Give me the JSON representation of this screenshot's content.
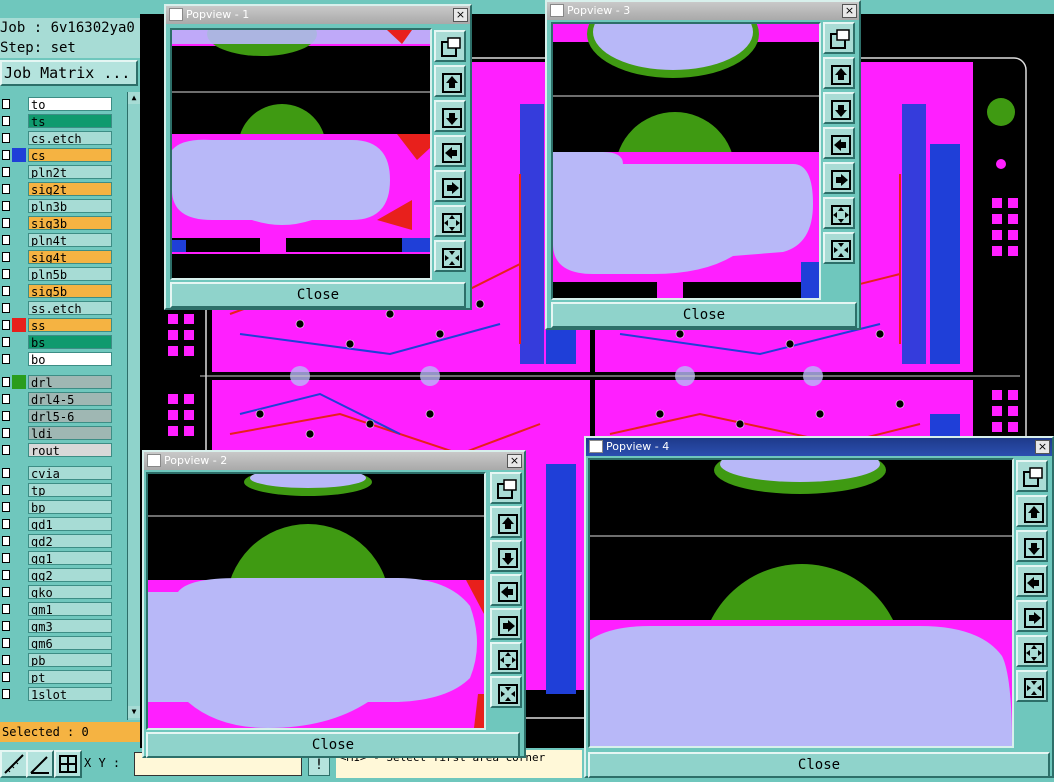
{
  "job_panel": {
    "job_line": "Job : 6v16302ya0",
    "step_line": "Step: set",
    "matrix_button": "Job Matrix ..."
  },
  "layers": [
    {
      "name": "to",
      "color": "#ffffff",
      "dot": ""
    },
    {
      "name": "ts",
      "color": "#0f9a6e",
      "dot": ""
    },
    {
      "name": "cs.etch",
      "color": "#a7dcd5",
      "dot": ""
    },
    {
      "name": "cs",
      "color": "#f5b342",
      "dot": "#1f3fd8"
    },
    {
      "name": "pln2t",
      "color": "#a7dcd5",
      "dot": ""
    },
    {
      "name": "sig2t",
      "color": "#f5b342",
      "dot": ""
    },
    {
      "name": "pln3b",
      "color": "#a7dcd5",
      "dot": ""
    },
    {
      "name": "sig3b",
      "color": "#f5b342",
      "dot": ""
    },
    {
      "name": "pln4t",
      "color": "#a7dcd5",
      "dot": ""
    },
    {
      "name": "sig4t",
      "color": "#f5b342",
      "dot": ""
    },
    {
      "name": "pln5b",
      "color": "#a7dcd5",
      "dot": ""
    },
    {
      "name": "sig5b",
      "color": "#f5b342",
      "dot": ""
    },
    {
      "name": "ss.etch",
      "color": "#a7dcd5",
      "dot": ""
    },
    {
      "name": "ss",
      "color": "#f5b342",
      "dot": "#e8201c"
    },
    {
      "name": "bs",
      "color": "#0f9a6e",
      "dot": ""
    },
    {
      "name": "bo",
      "color": "#ffffff",
      "dot": ""
    },
    {
      "name": "drl",
      "color": "#9fb7b3",
      "dot": "#2a9d1c"
    },
    {
      "name": "drl4-5",
      "color": "#9fb7b3",
      "dot": ""
    },
    {
      "name": "drl5-6",
      "color": "#9fb7b3",
      "dot": ""
    },
    {
      "name": "ldi",
      "color": "#9fb7b3",
      "dot": ""
    },
    {
      "name": "rout",
      "color": "#d8d8d8",
      "dot": ""
    },
    {
      "name": "cvia",
      "color": "#a7dcd5",
      "dot": ""
    },
    {
      "name": "tp",
      "color": "#a7dcd5",
      "dot": ""
    },
    {
      "name": "bp",
      "color": "#a7dcd5",
      "dot": ""
    },
    {
      "name": "gd1",
      "color": "#a7dcd5",
      "dot": ""
    },
    {
      "name": "gd2",
      "color": "#a7dcd5",
      "dot": ""
    },
    {
      "name": "gg1",
      "color": "#a7dcd5",
      "dot": ""
    },
    {
      "name": "gg2",
      "color": "#a7dcd5",
      "dot": ""
    },
    {
      "name": "gko",
      "color": "#a7dcd5",
      "dot": ""
    },
    {
      "name": "gm1",
      "color": "#a7dcd5",
      "dot": ""
    },
    {
      "name": "gm3",
      "color": "#a7dcd5",
      "dot": ""
    },
    {
      "name": "gm6",
      "color": "#a7dcd5",
      "dot": ""
    },
    {
      "name": "pb",
      "color": "#a7dcd5",
      "dot": ""
    },
    {
      "name": "pt",
      "color": "#a7dcd5",
      "dot": ""
    },
    {
      "name": "1slot",
      "color": "#a7dcd5",
      "dot": ""
    }
  ],
  "selected_text": "Selected : 0",
  "bottom_bar": {
    "xy_label": "X Y :",
    "xy_value": "",
    "prompt_icon": "!",
    "status": "<M1> - Select first area corner"
  },
  "popviews": [
    {
      "title": "Popview - 1",
      "close_label": "Close",
      "close_x": "×"
    },
    {
      "title": "Popview - 3",
      "close_label": "Close",
      "close_x": "×"
    },
    {
      "title": "Popview - 2",
      "close_label": "Close",
      "close_x": "×"
    },
    {
      "title": "Popview - 4",
      "close_label": "Close",
      "close_x": "×"
    }
  ],
  "popview_tool_icons": [
    "zoom-home-icon",
    "pan-up-icon",
    "pan-down-icon",
    "pan-left-icon",
    "pan-right-icon",
    "zoom-out-icon",
    "zoom-in-icon"
  ],
  "colors": {
    "panel": "#6fc7bd",
    "magenta": "#ff1fff",
    "lavender": "#b8b8f8",
    "green": "#3f9a12",
    "blue": "#1f3fd8",
    "red": "#e8201c",
    "orange": "#f5b342",
    "title_active": "#1e3a8a"
  }
}
